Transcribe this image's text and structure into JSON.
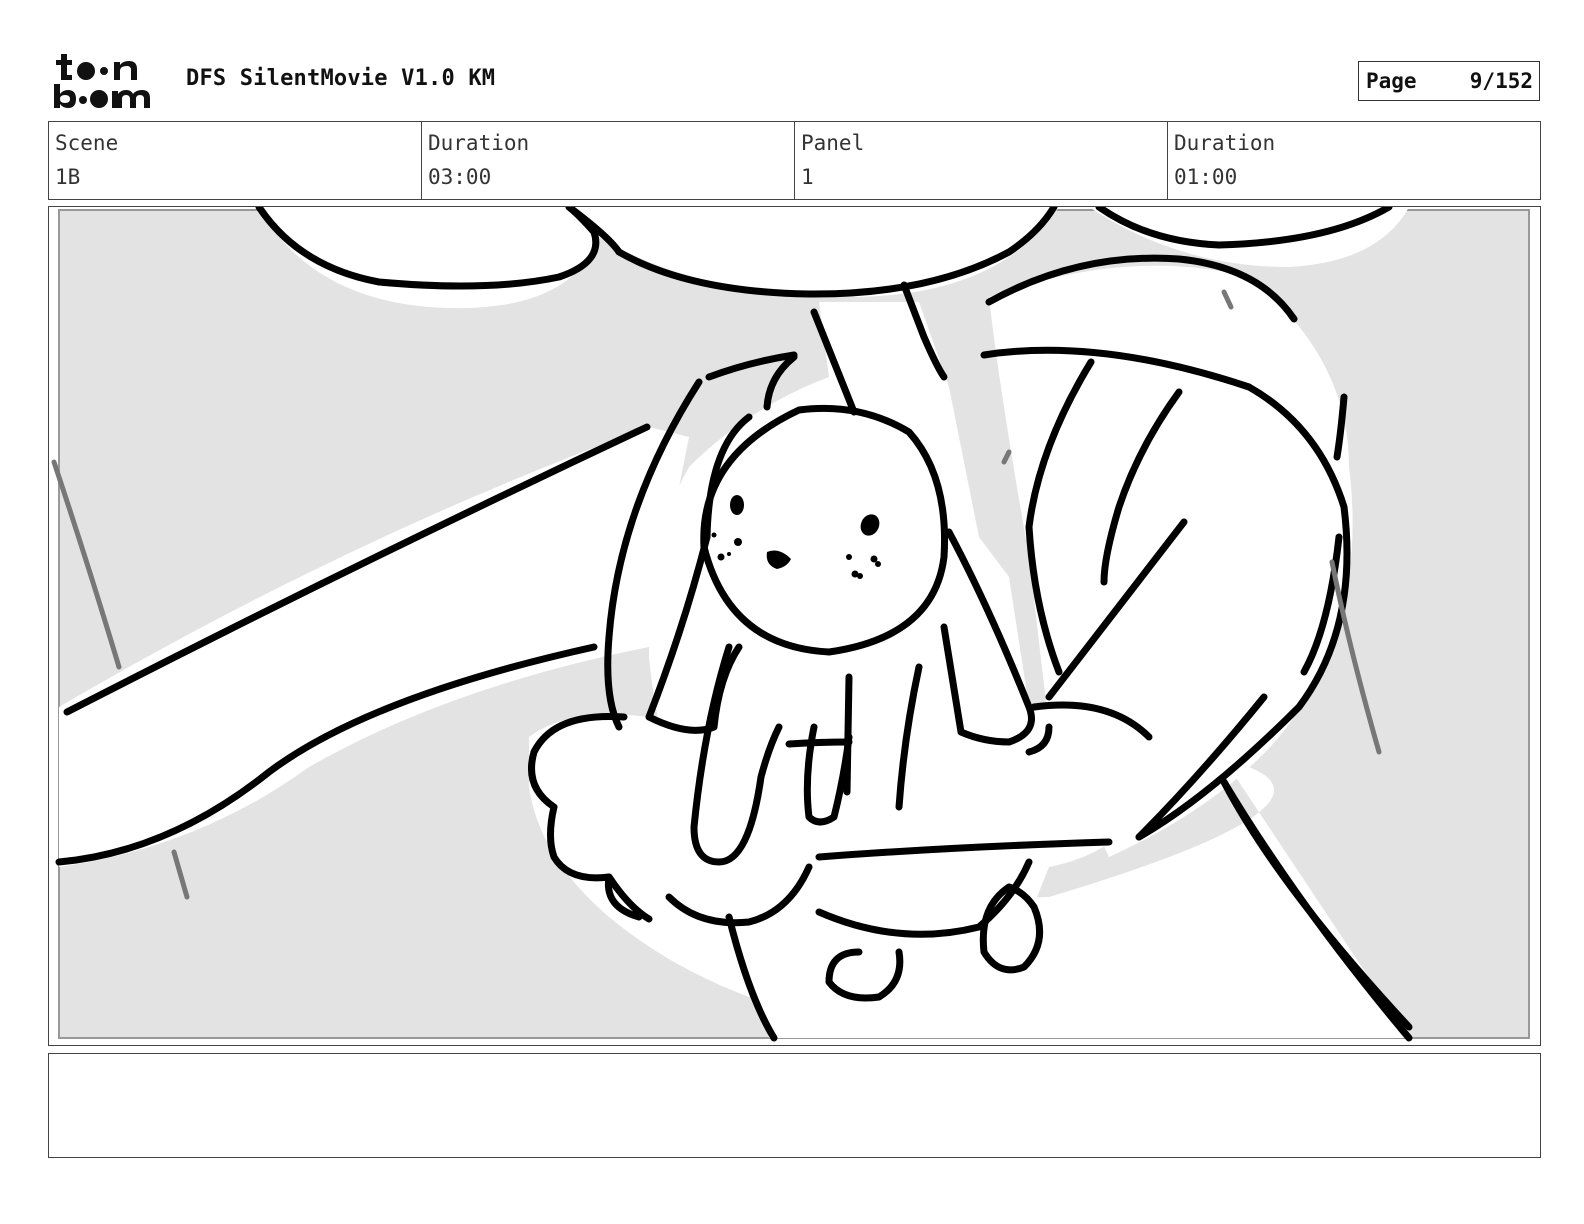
{
  "header": {
    "logo_text": "toon boom",
    "title": "DFS SilentMovie V1.0 KM",
    "page_label": "Page",
    "page_value": "9/152"
  },
  "info": {
    "scene_label": "Scene",
    "scene_value": "1B",
    "scene_duration_label": "Duration",
    "scene_duration_value": "03:00",
    "panel_label": "Panel",
    "panel_value": "1",
    "panel_duration_label": "Duration",
    "panel_duration_value": "01:00"
  },
  "colors": {
    "background_fill": "#e3e3e3",
    "ink": "#000000",
    "border": "#444444"
  },
  "notes": {
    "text": ""
  }
}
